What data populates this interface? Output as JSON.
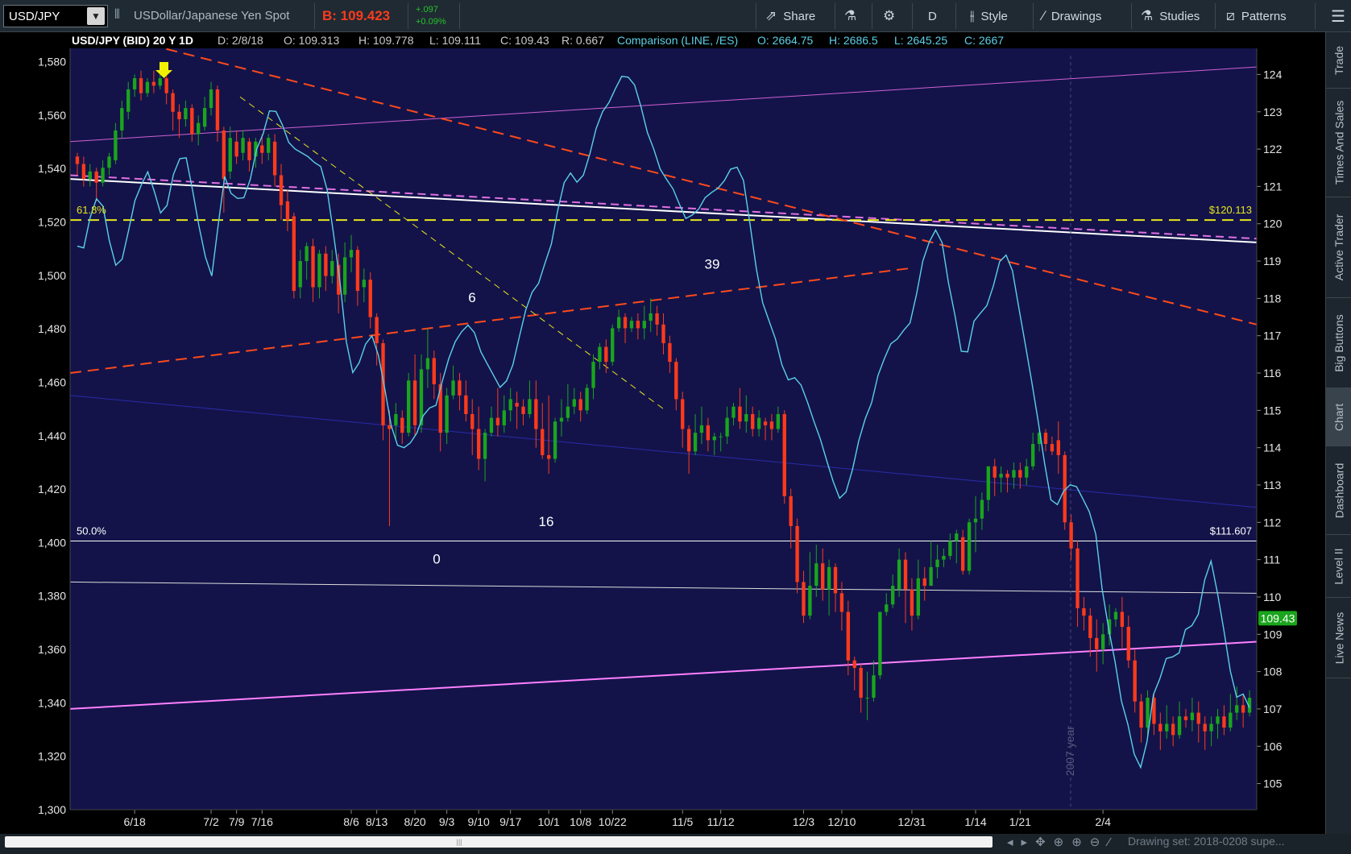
{
  "toolbar": {
    "symbol": "USD/JPY",
    "description": "USDollar/Japanese Yen Spot",
    "bid": "B: 109.423",
    "change_abs": "+.097",
    "change_pct": "+0.09%",
    "share": "Share",
    "period": "D",
    "style": "Style",
    "drawings": "Drawings",
    "studies": "Studies",
    "patterns": "Patterns"
  },
  "header": {
    "title": "USD/JPY (BID) 20 Y 1D",
    "date": "D: 2/8/18",
    "open": "O: 109.313",
    "high": "H: 109.778",
    "low": "L: 109.111",
    "close": "C: 109.43",
    "range": "R: 0.667",
    "comparison": "Comparison (LINE, /ES)",
    "comp_open": "O: 2664.75",
    "comp_high": "H: 2686.5",
    "comp_low": "L: 2645.25",
    "comp_close": "C: 2667"
  },
  "annotations": {
    "fib_618": "61.8%",
    "fib_500": "50.0%",
    "price_120": "$120.113",
    "price_111": "$111.607",
    "last_price": "109.43",
    "label_6": "6",
    "label_39": "39",
    "label_16": "16",
    "label_0": "0",
    "year_marker": "2007 year"
  },
  "side_tabs": [
    "Trade",
    "Times And Sales",
    "Active Trader",
    "Big Buttons",
    "Chart",
    "Dashboard",
    "Level II",
    "Live News"
  ],
  "bottom": {
    "drawing_set": "Drawing set: 2018-0208 supe..."
  },
  "colors": {
    "background": "#13134a",
    "up": "#1aa51c",
    "down": "#ff3a1a",
    "comparison": "#5cd0e8",
    "fib": "#e6e61a",
    "trend_red": "#ff4a1a",
    "trend_pink": "#e070e0"
  },
  "chart_data": {
    "type": "candlestick",
    "title": "USD/JPY (BID) 20 Y 1D",
    "x_tick_labels": [
      "6/18",
      "7/2",
      "7/9",
      "7/16",
      "8/6",
      "8/13",
      "8/20",
      "9/3",
      "9/10",
      "9/17",
      "10/1",
      "10/8",
      "10/22",
      "11/5",
      "11/12",
      "12/3",
      "12/10",
      "12/31",
      "1/14",
      "1/21",
      "2/4"
    ],
    "left_axis": {
      "label": "/ES",
      "ticks": [
        "1,580",
        "1,560",
        "1,540",
        "1,520",
        "1,500",
        "1,480",
        "1,460",
        "1,440",
        "1,420",
        "1,400",
        "1,380",
        "1,360",
        "1,340",
        "1,320",
        "1,300"
      ],
      "range": [
        1300,
        1585
      ]
    },
    "right_axis": {
      "label": "USD/JPY",
      "ticks": [
        "124",
        "123",
        "122",
        "121",
        "120",
        "119",
        "118",
        "117",
        "116",
        "115",
        "114",
        "113",
        "112",
        "111",
        "110",
        "109",
        "108",
        "107",
        "106",
        "105"
      ],
      "range": [
        104.3,
        124.7
      ]
    },
    "candles": [
      [
        121.8,
        121.6,
        121.9,
        121.3
      ],
      [
        121.6,
        121.2,
        121.8,
        121.0
      ],
      [
        121.2,
        121.4,
        121.6,
        121.0
      ],
      [
        121.4,
        121.1,
        121.5,
        120.6
      ],
      [
        121.1,
        121.5,
        121.7,
        121.0
      ],
      [
        121.5,
        121.8,
        121.9,
        121.3
      ],
      [
        121.7,
        122.5,
        122.7,
        121.6
      ],
      [
        122.5,
        123.1,
        123.3,
        122.3
      ],
      [
        123.0,
        123.6,
        123.8,
        122.8
      ],
      [
        123.6,
        123.9,
        124.0,
        123.4
      ],
      [
        123.9,
        123.5,
        124.1,
        123.3
      ],
      [
        123.5,
        123.8,
        123.9,
        123.4
      ],
      [
        123.8,
        123.7,
        124.1,
        123.5
      ],
      [
        123.7,
        123.9,
        124.2,
        123.6
      ],
      [
        123.9,
        123.5,
        124.0,
        123.2
      ],
      [
        123.5,
        123.0,
        123.6,
        122.5
      ],
      [
        123.0,
        122.8,
        123.2,
        122.3
      ],
      [
        122.8,
        123.1,
        123.3,
        122.6
      ],
      [
        123.1,
        122.4,
        123.2,
        122.2
      ],
      [
        122.4,
        122.7,
        122.9,
        122.1
      ],
      [
        122.6,
        123.1,
        123.4,
        122.5
      ],
      [
        123.1,
        123.6,
        123.8,
        122.9
      ],
      [
        123.6,
        122.5,
        123.7,
        122.2
      ],
      [
        122.5,
        121.2,
        122.6,
        120.3
      ],
      [
        121.4,
        122.3,
        122.6,
        121.2
      ],
      [
        122.2,
        121.8,
        122.5,
        121.6
      ],
      [
        121.9,
        122.3,
        122.5,
        121.7
      ],
      [
        122.2,
        121.7,
        122.3,
        121.4
      ],
      [
        121.8,
        122.2,
        122.3,
        121.5
      ],
      [
        122.1,
        121.9,
        122.4,
        121.6
      ],
      [
        121.9,
        122.3,
        122.4,
        121.7
      ],
      [
        122.2,
        121.3,
        122.4,
        121.0
      ],
      [
        121.3,
        120.5,
        121.6,
        120.1
      ],
      [
        120.6,
        120.1,
        120.9,
        119.8
      ],
      [
        120.2,
        118.2,
        120.3,
        118.0
      ],
      [
        118.3,
        119.0,
        119.3,
        118.0
      ],
      [
        119.0,
        119.4,
        119.5,
        118.5
      ],
      [
        119.4,
        118.3,
        119.6,
        117.9
      ],
      [
        118.3,
        119.2,
        119.3,
        118.0
      ],
      [
        119.2,
        118.6,
        119.4,
        118.2
      ],
      [
        118.6,
        119.0,
        119.3,
        118.4
      ],
      [
        118.9,
        118.1,
        119.2,
        117.6
      ],
      [
        118.1,
        119.1,
        119.5,
        117.9
      ],
      [
        119.1,
        119.3,
        119.7,
        118.7
      ],
      [
        119.3,
        118.2,
        119.4,
        117.8
      ],
      [
        118.3,
        118.5,
        118.8,
        117.9
      ],
      [
        118.5,
        117.5,
        118.7,
        117.2
      ],
      [
        117.5,
        116.8,
        117.6,
        116.2
      ],
      [
        116.8,
        114.6,
        116.9,
        114.2
      ],
      [
        114.6,
        114.5,
        115.0,
        111.9
      ],
      [
        114.6,
        114.9,
        115.2,
        114.2
      ],
      [
        114.8,
        114.4,
        115.0,
        114.1
      ],
      [
        114.4,
        115.8,
        116.0,
        114.3
      ],
      [
        115.8,
        114.6,
        116.5,
        114.3
      ],
      [
        114.6,
        116.1,
        116.5,
        114.4
      ],
      [
        116.1,
        116.4,
        117.2,
        115.6
      ],
      [
        116.4,
        115.7,
        116.6,
        115.3
      ],
      [
        115.7,
        114.4,
        116.0,
        113.9
      ],
      [
        114.4,
        115.4,
        115.6,
        114.1
      ],
      [
        115.4,
        115.8,
        116.2,
        115.3
      ],
      [
        115.8,
        115.4,
        116.0,
        115.0
      ],
      [
        115.4,
        114.9,
        115.8,
        114.7
      ],
      [
        114.9,
        114.5,
        115.3,
        113.8
      ],
      [
        114.5,
        113.7,
        115.1,
        113.4
      ],
      [
        113.7,
        114.4,
        114.5,
        113.1
      ],
      [
        114.4,
        114.8,
        115.1,
        114.3
      ],
      [
        114.8,
        114.6,
        115.6,
        114.3
      ],
      [
        114.6,
        115.0,
        115.4,
        114.4
      ],
      [
        115.0,
        115.3,
        115.6,
        114.7
      ],
      [
        115.2,
        115.1,
        115.5,
        114.5
      ],
      [
        115.1,
        114.9,
        115.3,
        114.6
      ],
      [
        114.9,
        115.3,
        115.8,
        114.8
      ],
      [
        115.3,
        114.5,
        115.8,
        114.0
      ],
      [
        114.5,
        113.8,
        115.2,
        113.7
      ],
      [
        113.8,
        113.7,
        115.4,
        113.3
      ],
      [
        113.7,
        114.7,
        114.8,
        113.6
      ],
      [
        114.7,
        114.8,
        115.3,
        114.3
      ],
      [
        114.8,
        115.1,
        115.7,
        114.7
      ],
      [
        115.1,
        115.3,
        115.6,
        114.9
      ],
      [
        115.3,
        115.0,
        115.5,
        114.7
      ],
      [
        115.0,
        115.6,
        115.7,
        114.9
      ],
      [
        115.6,
        116.3,
        116.5,
        115.3
      ],
      [
        116.3,
        116.7,
        116.8,
        116.1
      ],
      [
        116.7,
        116.3,
        116.9,
        116.0
      ],
      [
        116.3,
        117.2,
        117.3,
        116.2
      ],
      [
        117.2,
        117.5,
        117.7,
        117.1
      ],
      [
        117.5,
        117.2,
        117.6,
        116.8
      ],
      [
        117.2,
        117.4,
        117.5,
        117.1
      ],
      [
        117.4,
        117.2,
        117.6,
        116.9
      ],
      [
        117.2,
        117.4,
        117.8,
        116.9
      ],
      [
        117.4,
        117.6,
        118.0,
        117.1
      ],
      [
        117.6,
        117.3,
        117.8,
        117.0
      ],
      [
        117.3,
        116.8,
        117.6,
        116.5
      ],
      [
        116.8,
        116.3,
        117.0,
        116.0
      ],
      [
        116.3,
        115.3,
        116.4,
        115.0
      ],
      [
        115.3,
        114.5,
        115.5,
        114.0
      ],
      [
        114.5,
        113.9,
        114.6,
        113.3
      ],
      [
        113.9,
        114.4,
        114.9,
        113.8
      ],
      [
        114.4,
        114.6,
        115.1,
        114.1
      ],
      [
        114.6,
        114.2,
        114.8,
        113.9
      ],
      [
        114.2,
        114.3,
        114.4,
        113.8
      ],
      [
        114.3,
        114.3,
        114.4,
        113.9
      ],
      [
        114.3,
        114.8,
        115.1,
        114.1
      ],
      [
        114.8,
        115.1,
        115.2,
        114.6
      ],
      [
        115.1,
        114.7,
        115.6,
        114.5
      ],
      [
        114.7,
        114.9,
        115.4,
        114.4
      ],
      [
        114.9,
        114.5,
        115.1,
        114.3
      ],
      [
        114.5,
        114.8,
        115.0,
        114.3
      ],
      [
        114.7,
        114.6,
        114.8,
        114.2
      ],
      [
        114.7,
        114.5,
        114.9,
        114.2
      ],
      [
        114.5,
        114.9,
        115.1,
        114.4
      ],
      [
        114.9,
        112.7,
        115.0,
        112.5
      ],
      [
        112.7,
        111.9,
        112.9,
        111.3
      ],
      [
        111.9,
        110.4,
        112.1,
        110.1
      ],
      [
        110.4,
        109.5,
        110.7,
        109.3
      ],
      [
        109.5,
        110.3,
        111.2,
        109.4
      ],
      [
        110.3,
        110.9,
        111.4,
        110.0
      ],
      [
        110.9,
        110.2,
        111.3,
        109.9
      ],
      [
        110.2,
        110.8,
        111.0,
        109.5
      ],
      [
        110.8,
        110.1,
        110.9,
        109.6
      ],
      [
        110.1,
        109.6,
        110.4,
        109.1
      ],
      [
        109.6,
        108.3,
        109.9,
        107.9
      ],
      [
        108.3,
        108.1,
        108.4,
        107.5
      ],
      [
        108.1,
        107.3,
        108.2,
        106.9
      ],
      [
        107.3,
        107.3,
        108.0,
        106.7
      ],
      [
        107.3,
        107.9,
        108.3,
        107.2
      ],
      [
        107.9,
        109.6,
        109.6,
        107.8
      ],
      [
        109.6,
        109.8,
        110.1,
        109.5
      ],
      [
        109.8,
        110.3,
        110.6,
        109.7
      ],
      [
        110.2,
        111.0,
        111.3,
        110.0
      ],
      [
        111.0,
        110.2,
        111.2,
        109.3
      ],
      [
        110.2,
        109.5,
        110.5,
        109.1
      ],
      [
        109.5,
        110.5,
        111.0,
        109.4
      ],
      [
        110.5,
        110.3,
        110.8,
        109.9
      ],
      [
        110.3,
        110.8,
        111.5,
        110.3
      ],
      [
        110.8,
        111.0,
        111.4,
        110.5
      ],
      [
        111.0,
        111.1,
        111.3,
        110.8
      ],
      [
        111.1,
        111.5,
        111.7,
        111.0
      ],
      [
        111.5,
        111.7,
        111.8,
        110.9
      ],
      [
        111.6,
        110.7,
        111.8,
        110.6
      ],
      [
        110.7,
        112.0,
        112.1,
        110.6
      ],
      [
        112.0,
        112.1,
        112.7,
        111.2
      ],
      [
        112.1,
        112.6,
        112.8,
        111.8
      ],
      [
        112.6,
        113.5,
        113.5,
        112.3
      ],
      [
        113.5,
        113.2,
        113.7,
        112.7
      ],
      [
        113.2,
        113.3,
        113.5,
        112.8
      ],
      [
        113.3,
        113.2,
        113.4,
        112.8
      ],
      [
        113.2,
        113.4,
        113.6,
        112.9
      ],
      [
        113.4,
        113.2,
        113.6,
        112.9
      ],
      [
        113.2,
        113.5,
        113.7,
        113.0
      ],
      [
        113.5,
        114.1,
        114.4,
        113.4
      ],
      [
        114.1,
        114.4,
        114.5,
        113.9
      ],
      [
        114.4,
        114.1,
        114.5,
        113.9
      ],
      [
        114.1,
        113.9,
        114.3,
        113.8
      ],
      [
        114.2,
        113.8,
        114.7,
        113.3
      ],
      [
        113.8,
        112.0,
        113.9,
        111.8
      ],
      [
        112.0,
        111.3,
        112.2,
        111.0
      ],
      [
        111.3,
        109.7,
        111.5,
        109.2
      ],
      [
        109.7,
        109.5,
        110.0,
        109.1
      ],
      [
        109.5,
        108.9,
        109.7,
        108.4
      ],
      [
        108.9,
        108.6,
        109.4,
        108.0
      ],
      [
        108.6,
        109.0,
        109.3,
        108.2
      ],
      [
        109.0,
        109.4,
        109.8,
        108.7
      ],
      [
        109.4,
        109.6,
        109.7,
        109.2
      ],
      [
        109.6,
        109.2,
        110.0,
        108.6
      ],
      [
        109.2,
        108.3,
        109.5,
        108.1
      ],
      [
        108.3,
        107.2,
        108.6,
        106.9
      ],
      [
        107.2,
        106.5,
        107.4,
        106.1
      ],
      [
        106.5,
        107.3,
        107.5,
        106.3
      ],
      [
        107.3,
        106.6,
        107.4,
        106.3
      ],
      [
        106.6,
        106.4,
        106.9,
        105.9
      ],
      [
        106.4,
        106.6,
        107.1,
        106.2
      ],
      [
        106.6,
        106.3,
        106.8,
        106.0
      ],
      [
        106.3,
        106.8,
        107.2,
        106.2
      ],
      [
        106.8,
        106.7,
        107.0,
        106.5
      ],
      [
        106.7,
        106.9,
        107.3,
        106.4
      ],
      [
        106.9,
        106.6,
        107.2,
        106.1
      ],
      [
        106.6,
        106.4,
        106.8,
        105.9
      ],
      [
        106.4,
        106.6,
        106.8,
        106.0
      ],
      [
        106.6,
        106.8,
        107.0,
        106.2
      ],
      [
        106.8,
        106.5,
        107.1,
        106.3
      ],
      [
        106.5,
        106.9,
        107.4,
        106.4
      ],
      [
        106.9,
        107.1,
        107.6,
        106.7
      ],
      [
        107.1,
        106.9,
        107.4,
        106.5
      ],
      [
        106.9,
        107.3,
        107.5,
        106.8
      ]
    ],
    "comparison_series": [
      1511.0,
      1510.3,
      1521.7,
      1528.7,
      1525.9,
      1513.0,
      1503.8,
      1506.1,
      1516.8,
      1528.0,
      1533.9,
      1538.8,
      1531.6,
      1523.4,
      1526.2,
      1537.7,
      1543.7,
      1544.0,
      1531.8,
      1518.4,
      1506.9,
      1499.8,
      1519.0,
      1537.0,
      1530.7,
      1528.8,
      1529.1,
      1536.0,
      1547.3,
      1553.0,
      1561.6,
      1561.4,
      1556.4,
      1549.8,
      1547.3,
      1545.9,
      1544.5,
      1542.3,
      1540.8,
      1532.0,
      1515.6,
      1497.6,
      1475.2,
      1463.6,
      1467.3,
      1474.3,
      1477.4,
      1470.1,
      1457.6,
      1443.8,
      1436.4,
      1435.5,
      1437.3,
      1441.0,
      1447.5,
      1450.4,
      1451.4,
      1460.6,
      1468.9,
      1475.2,
      1478.9,
      1481.4,
      1478.6,
      1471.4,
      1466.9,
      1462.5,
      1458.1,
      1460.5,
      1466.5,
      1476.9,
      1487.0,
      1493.7,
      1497.0,
      1504.5,
      1511.7,
      1524.3,
      1534.7,
      1538.3,
      1534.9,
      1537.5,
      1545.4,
      1555.0,
      1561.3,
      1564.7,
      1569.9,
      1574.5,
      1574.2,
      1571.3,
      1563.1,
      1553.5,
      1547.2,
      1539.8,
      1535.9,
      1532.4,
      1526.6,
      1521.3,
      1522.6,
      1524.8,
      1529.1,
      1531.0,
      1532.6,
      1535.4,
      1539.8,
      1540.5,
      1535.5,
      1519.6,
      1502.6,
      1489.8,
      1482.9,
      1476.2,
      1466.5,
      1460.9,
      1461.7,
      1458.9,
      1452.5,
      1445.3,
      1438.7,
      1430.6,
      1422.9,
      1416.6,
      1418.9,
      1427.2,
      1438.1,
      1446.3,
      1452.3,
      1462.6,
      1468.9,
      1474.4,
      1476.2,
      1479.4,
      1482.2,
      1492.8,
      1505.4,
      1512.5,
      1517.0,
      1512.3,
      1497.3,
      1485.2,
      1471.6,
      1471.4,
      1482.9,
      1485.9,
      1488.7,
      1496.0,
      1505.2,
      1507.6,
      1501.7,
      1487.7,
      1474.2,
      1460.2,
      1445.6,
      1429.8,
      1416.0,
      1414.2,
      1419.3,
      1421.6,
      1420.9,
      1416.3,
      1411.5,
      1403.1,
      1382.5,
      1367.9,
      1355.4,
      1340.7,
      1332.0,
      1320.8,
      1315.8,
      1325.5,
      1343.1,
      1349.0,
      1356.6,
      1357.2,
      1358.7,
      1367.4,
      1368.9,
      1373.1,
      1386.0,
      1393.1,
      1381.0,
      1367.2,
      1351.9,
      1342.1,
      1343.3,
      1338.2
    ]
  }
}
